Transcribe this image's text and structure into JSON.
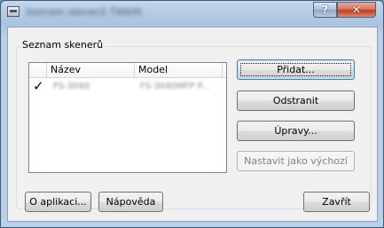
{
  "window": {
    "title": "Seznam skenerů TWAIN",
    "help_label": "?",
    "close_label": "✕"
  },
  "group": {
    "label": "Seznam skenerů"
  },
  "list": {
    "columns": [
      "Název",
      "Model"
    ],
    "rows": [
      {
        "checked": "✓",
        "name": "FS-3040",
        "model": "FS-3040MFP P..."
      }
    ]
  },
  "buttons": {
    "add": "Přidat...",
    "remove": "Odstranit",
    "edit": "Úpravy...",
    "set_default": "Nastavit jako výchozí",
    "about": "O aplikaci...",
    "help": "Nápověda",
    "close": "Zavřít"
  }
}
